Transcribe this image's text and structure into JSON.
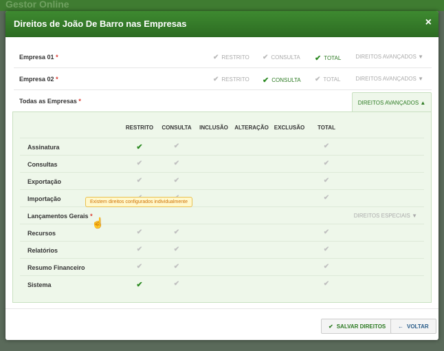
{
  "background": {
    "app_title": "Gestor Online"
  },
  "modal": {
    "title": "Direitos de João De Barro nas Empresas",
    "close_icon": "×"
  },
  "permission_labels": {
    "restrito": "RESTRITO",
    "consulta": "CONSULTA",
    "total": "TOTAL"
  },
  "check_glyph": "✔",
  "required_mark": "*",
  "companies": [
    {
      "name": "Empresa 01",
      "selected": "total",
      "advanced_label": "DIREITOS AVANÇADOS ▼"
    },
    {
      "name": "Empresa 02",
      "selected": "consulta",
      "advanced_label": "DIREITOS AVANÇADOS ▼"
    }
  ],
  "all_companies": {
    "name": "Todas as Empresas",
    "advanced_label": "DIREITOS AVANÇADOS ▲"
  },
  "table": {
    "columns": [
      "RESTRITO",
      "CONSULTA",
      "INCLUSÃO",
      "ALTERAÇÃO",
      "EXCLUSÃO",
      "TOTAL"
    ],
    "rows": [
      {
        "label": "Assinatura",
        "restrito": "on",
        "consulta": "off",
        "total": "off"
      },
      {
        "label": "Consultas",
        "restrito": "off",
        "consulta": "off",
        "total": "off"
      },
      {
        "label": "Exportação",
        "restrito": "off",
        "consulta": "off",
        "total": "off"
      },
      {
        "label": "Importação",
        "restrito": "off",
        "consulta": "off",
        "total": "off"
      },
      {
        "label": "Lançamentos Gerais",
        "restrito": "none",
        "consulta": "none",
        "total": "none",
        "required": true,
        "special": "DIREITOS ESPECIAIS ▼"
      },
      {
        "label": "Recursos",
        "restrito": "off",
        "consulta": "off",
        "total": "off"
      },
      {
        "label": "Relatórios",
        "restrito": "off",
        "consulta": "off",
        "total": "off"
      },
      {
        "label": "Resumo Financeiro",
        "restrito": "off",
        "consulta": "off",
        "total": "off"
      },
      {
        "label": "Sistema",
        "restrito": "on",
        "consulta": "off",
        "total": "off"
      }
    ]
  },
  "tooltip": "Existem direitos configurados individualmente",
  "footer": {
    "save_label": "SALVAR DIREITOS",
    "save_icon": "✔",
    "back_label": "VOLTAR",
    "back_icon": "←"
  },
  "colors": {
    "brand_green": "#2c7a22",
    "header_green": "#3e8a30",
    "required_red": "#d9342b",
    "tooltip_text": "#d07000"
  }
}
